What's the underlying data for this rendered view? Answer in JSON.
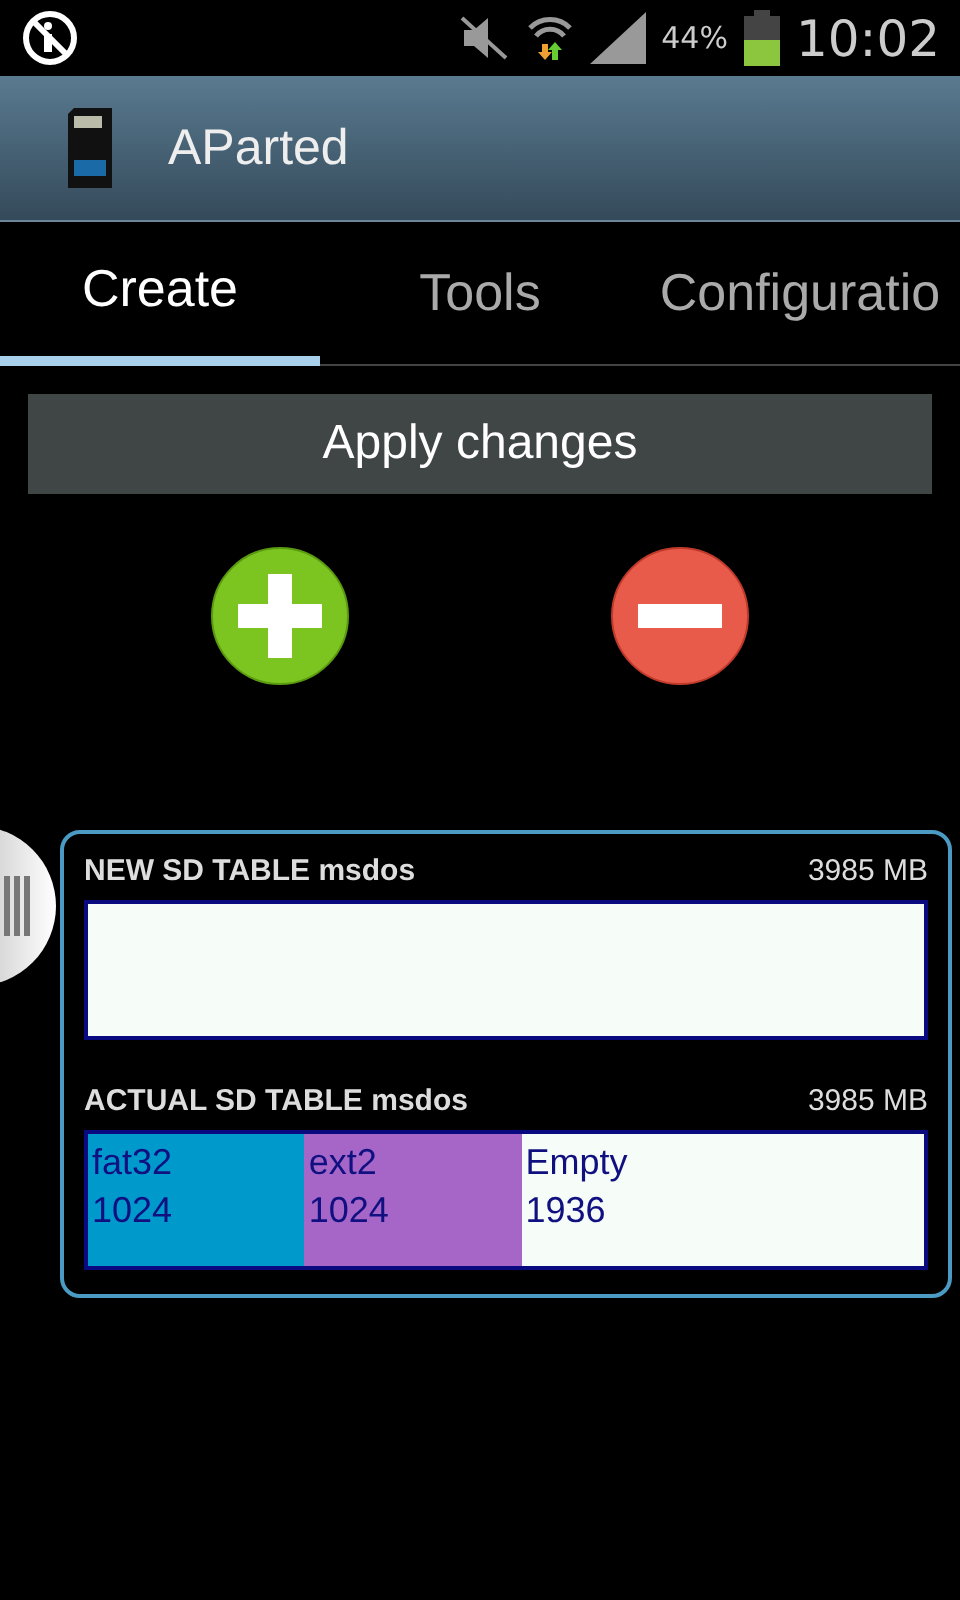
{
  "status_bar": {
    "battery": "44%",
    "time": "10:02"
  },
  "app_bar": {
    "title": "AParted"
  },
  "tabs": [
    {
      "label": "Create",
      "selected": true
    },
    {
      "label": "Tools",
      "selected": false
    },
    {
      "label": "Configuratio",
      "selected": false
    }
  ],
  "apply_button": "Apply changes",
  "tables": [
    {
      "title": "NEW SD TABLE msdos",
      "size": "3985 MB"
    },
    {
      "title": "ACTUAL SD TABLE msdos",
      "size": "3985 MB",
      "partitions": [
        {
          "type": "fat32",
          "size": "1024",
          "color": "#0099cc"
        },
        {
          "type": "ext2",
          "size": "1024",
          "color": "#a666c8"
        },
        {
          "type": "Empty",
          "size": "1936",
          "color": "#f6fcf8"
        }
      ]
    }
  ]
}
